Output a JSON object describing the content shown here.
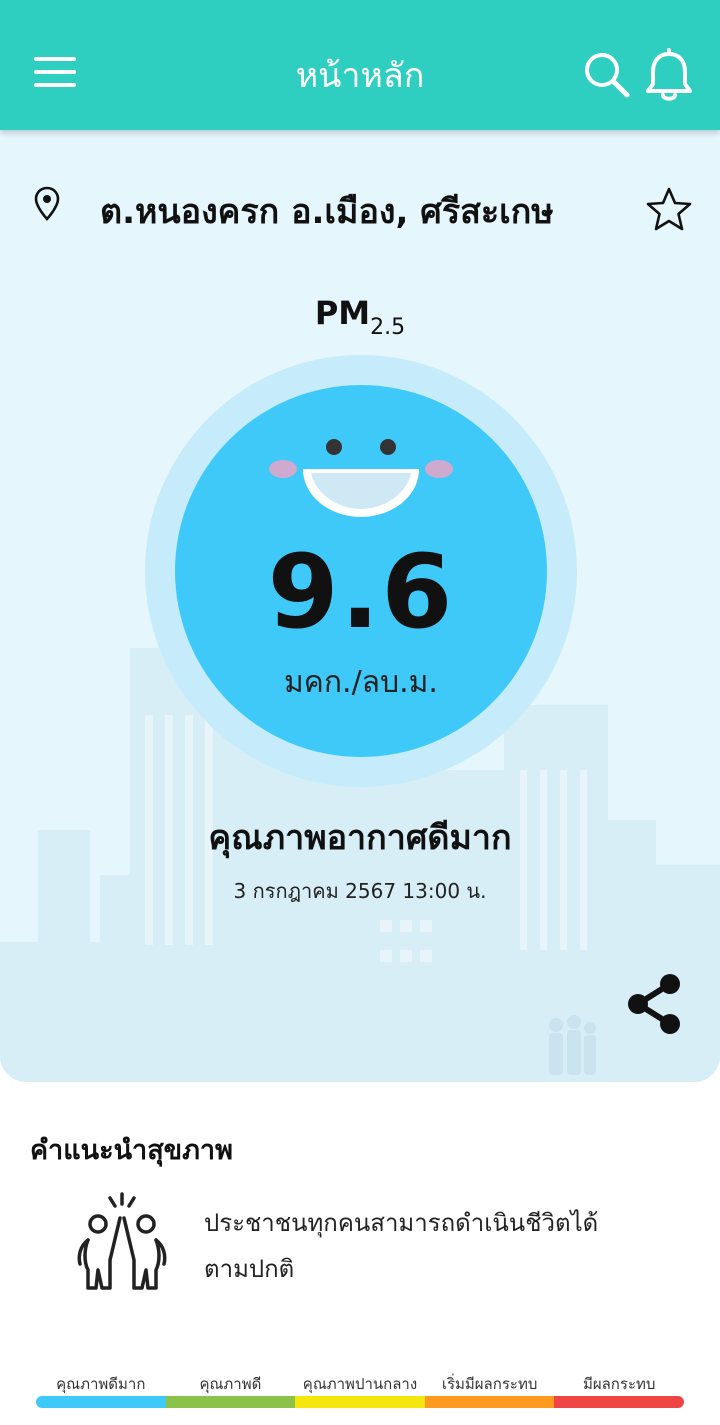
{
  "header": {
    "title": "หน้าหลัก",
    "menu_icon": "hamburger-menu-icon",
    "search_icon": "search-icon",
    "bell_icon": "bell-icon",
    "color": "#2ecec0"
  },
  "location": {
    "name": "ต.หนองครก อ.เมือง, ศรีสะเกษ",
    "pin_icon": "map-pin-icon",
    "favorite_icon": "star-icon"
  },
  "pm": {
    "label": "PM",
    "subscript": "2.5",
    "value": "9.6",
    "unit": "มคก./ลบ.ม.",
    "face_icon": "smiley-face-icon",
    "gauge_color": "#3ec9f9"
  },
  "status": {
    "quality": "คุณภาพอากาศดีมาก",
    "timestamp": "3 กรกฎาคม 2567  13:00 น.",
    "share_icon": "share-icon"
  },
  "advice": {
    "title": "คำแนะนำสุขภาพ",
    "icon": "high-five-people-icon",
    "text": "ประชาชนทุกคนสามารถดำเนินชีวิตได้ตามปกติ"
  },
  "legend": [
    {
      "label": "คุณภาพดีมาก",
      "color": "#3ec9f9"
    },
    {
      "label": "คุณภาพดี",
      "color": "#8bc34a"
    },
    {
      "label": "คุณภาพปานกลาง",
      "color": "#f5e60e"
    },
    {
      "label": "เริ่มมีผลกระทบ",
      "color": "#ff9a1f"
    },
    {
      "label": "มีผลกระทบ",
      "color": "#f04545"
    }
  ]
}
